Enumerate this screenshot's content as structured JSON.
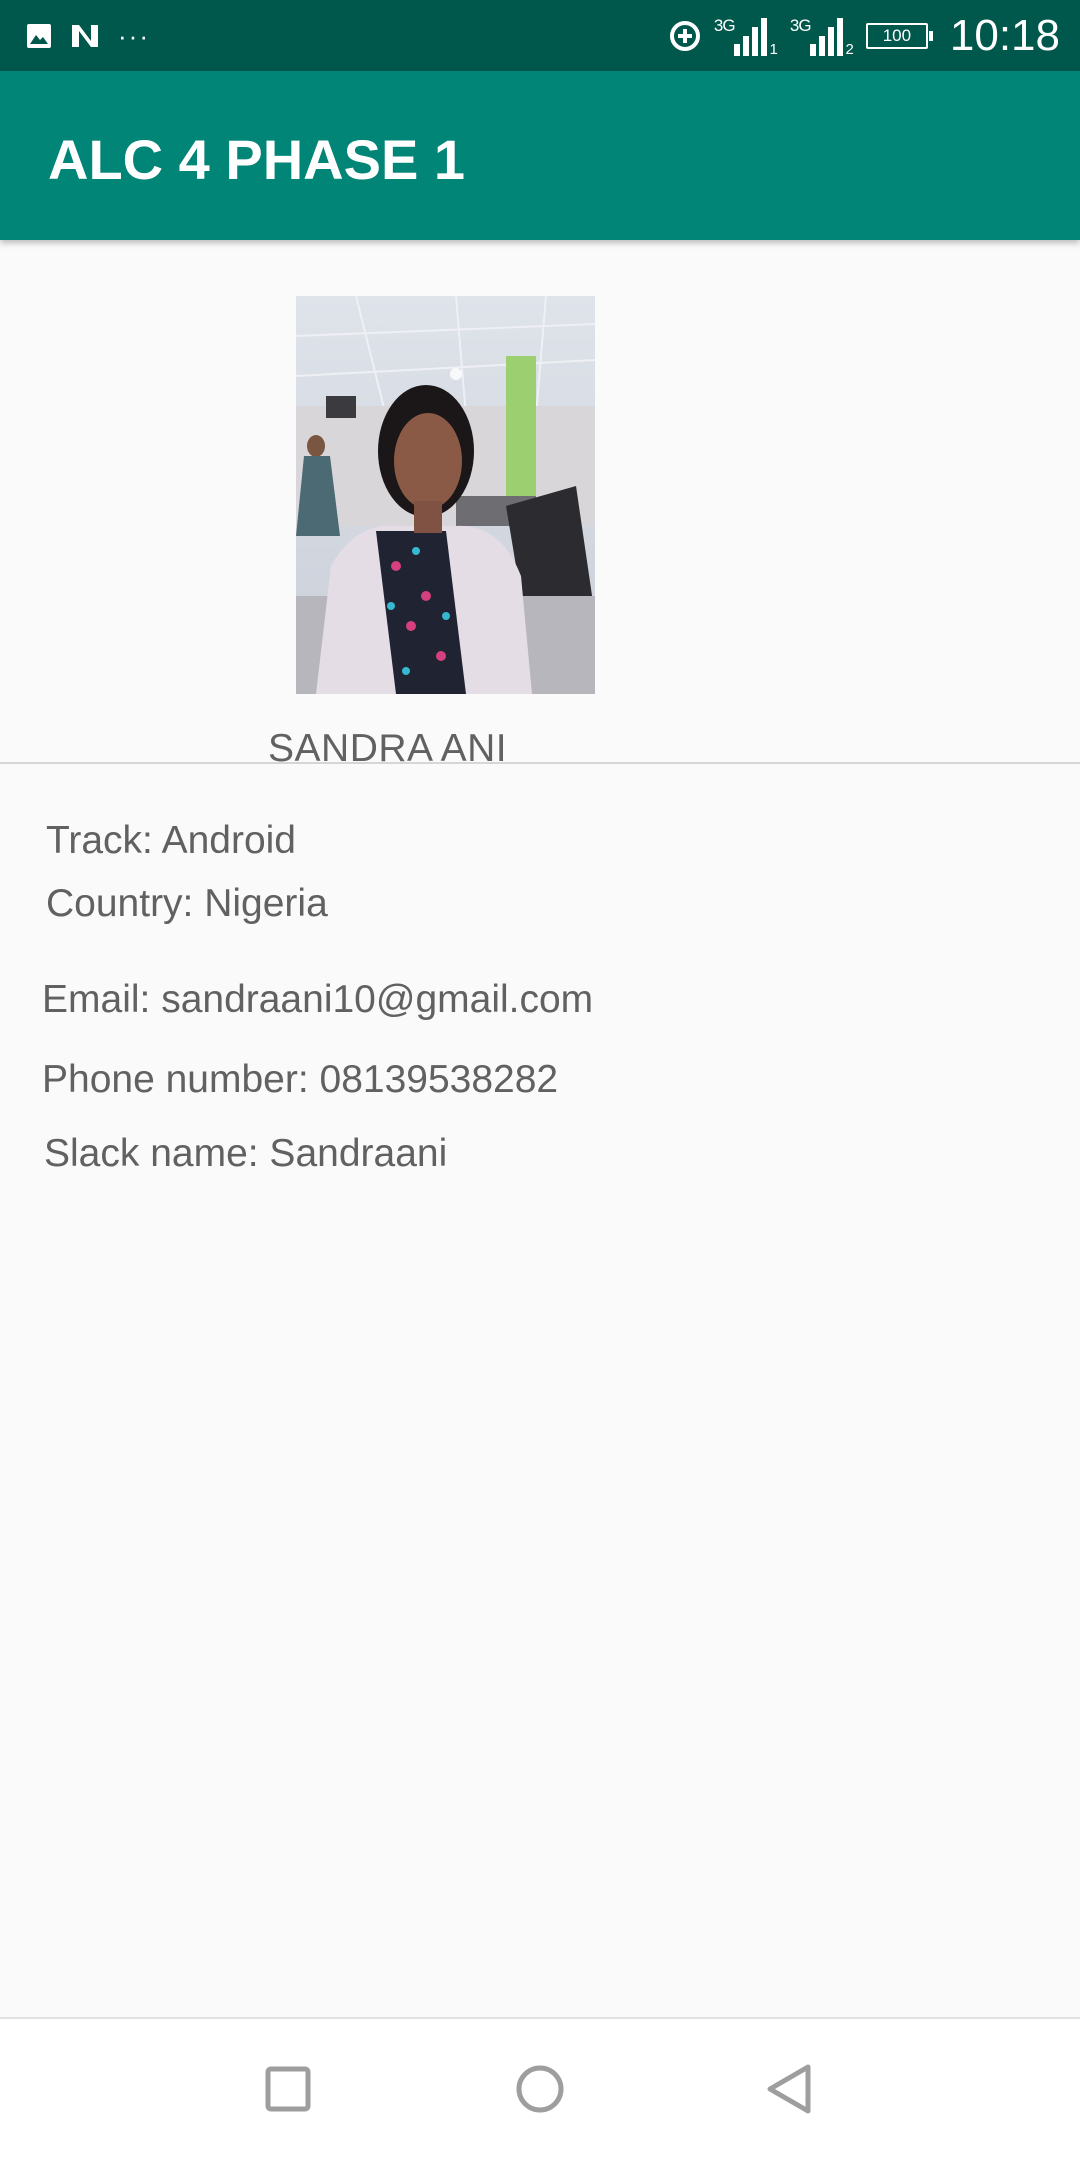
{
  "status_bar": {
    "left_icons": [
      "gallery-icon",
      "n-icon",
      "more-dots-icon"
    ],
    "overflow_text": "···",
    "network_1": "3G",
    "sim_1": "1",
    "network_2": "3G",
    "sim_2": "2",
    "battery": "100",
    "time": "10:18"
  },
  "app_bar": {
    "title": "ALC 4 PHASE 1",
    "color": "#008577",
    "status_color": "#00574b"
  },
  "profile": {
    "name": "SANDRA ANI",
    "track": "Track: Android",
    "country": "Country: Nigeria",
    "email": "Email: sandraani10@gmail.com",
    "phone": "Phone number: 08139538282",
    "slack": "Slack name: Sandraani"
  },
  "nav_bar": {
    "buttons": [
      "recents-button",
      "home-button",
      "back-button"
    ]
  }
}
